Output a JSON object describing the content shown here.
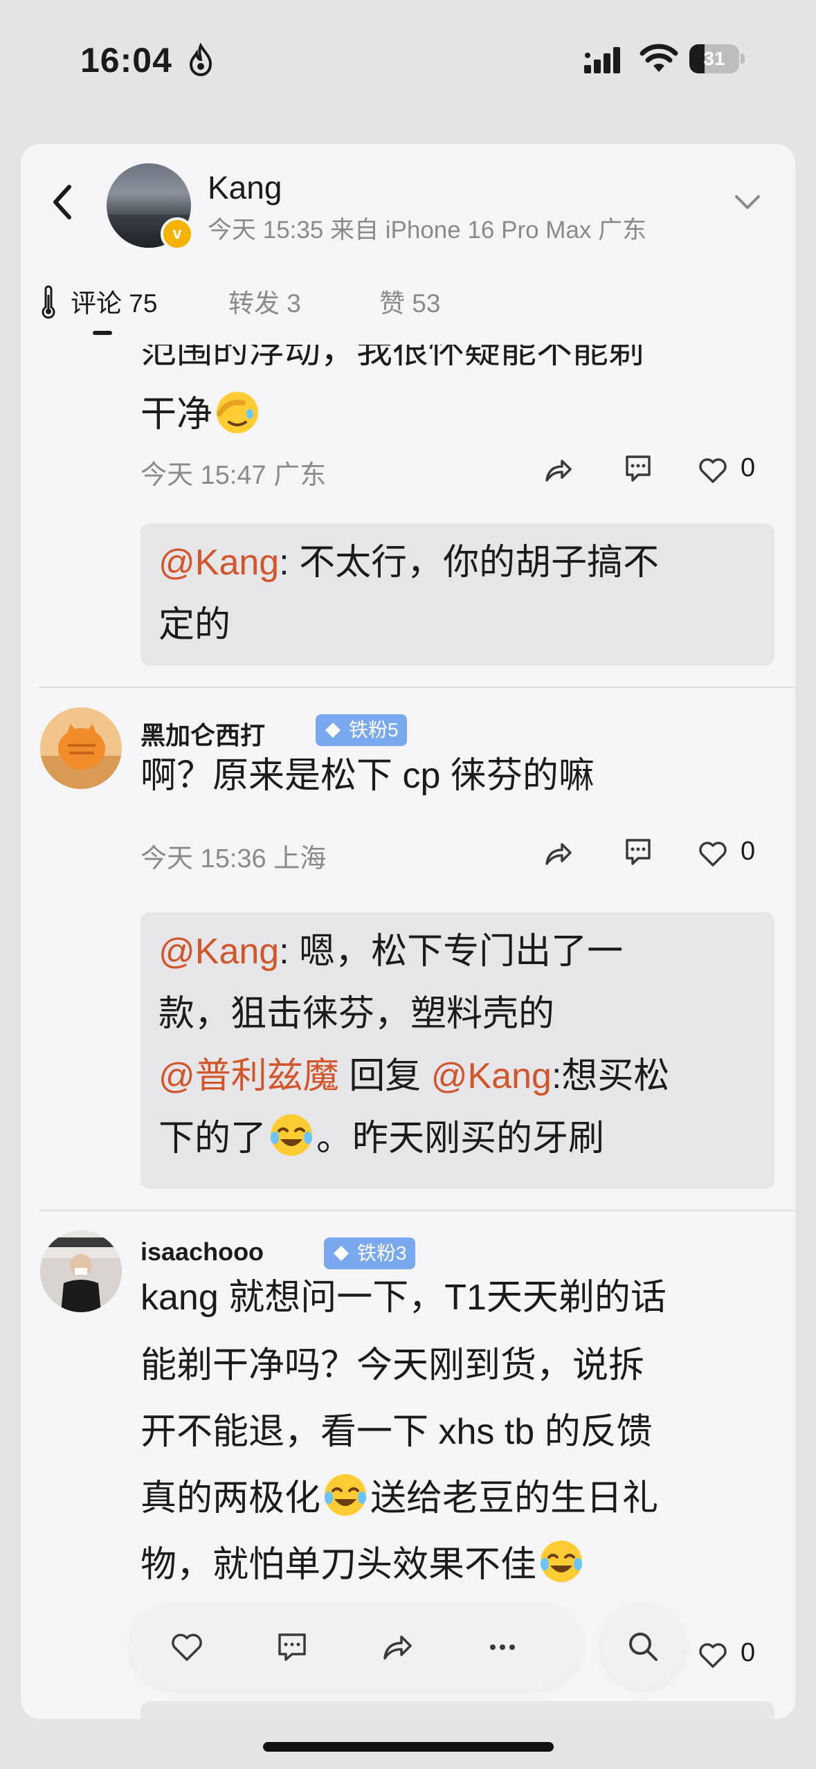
{
  "status_bar": {
    "time": "16:04",
    "battery": "31",
    "battery_level": 0.31
  },
  "header": {
    "name": "Kang",
    "meta": "今天 15:35  来自 iPhone 16 Pro Max   广东",
    "verified_badge": "v"
  },
  "tabs": [
    {
      "label": "评论 75"
    },
    {
      "label": "转发 3"
    },
    {
      "label": "赞 53"
    }
  ],
  "comments": [
    {
      "text_lines": [
        "范围的浮动，我很怀疑能不能剃",
        "干净"
      ],
      "meta": "今天 15:47   广东",
      "likes": "0",
      "reply": {
        "lines": [
          {
            "mention": "@Kang",
            "text": ": 不太行，你的胡子搞不"
          },
          {
            "text": "定的"
          }
        ]
      }
    },
    {
      "author": "黑加仑西打",
      "fan_badge": "铁粉5",
      "text_lines": [
        "啊？原来是松下 cp 徕芬的嘛"
      ],
      "meta": "今天 15:36   上海",
      "likes": "0",
      "reply": {
        "lines": [
          {
            "mention": "@Kang",
            "text": ": 嗯，松下专门出了一"
          },
          {
            "text": "款，狙击徕芬，塑料壳的"
          },
          {
            "mention": "@普利兹魔",
            "text": " 回复 ",
            "mention2": "@Kang",
            "text2": ":想买松"
          },
          {
            "text": "下的了",
            "text_after_emoji": "。昨天刚买的牙刷"
          }
        ]
      }
    },
    {
      "author": "isaachooo",
      "fan_badge": "铁粉3",
      "text_lines": [
        "kang 就想问一下，T1天天剃的话",
        "能剃干净吗？今天刚到货，说拆",
        "开不能退，看一下 xhs tb 的反馈",
        "真的两极化",
        "送给老豆的生日礼",
        "物，就怕单刀头效果不佳"
      ],
      "likes": "0"
    }
  ],
  "toolbar": {
    "icons": [
      "heart-icon",
      "comment-icon",
      "share-icon",
      "more-icon",
      "search-icon"
    ]
  },
  "colors": {
    "mention": "#d2562c",
    "fan_badge": "#7aa8ef",
    "verified": "#f5b300"
  }
}
